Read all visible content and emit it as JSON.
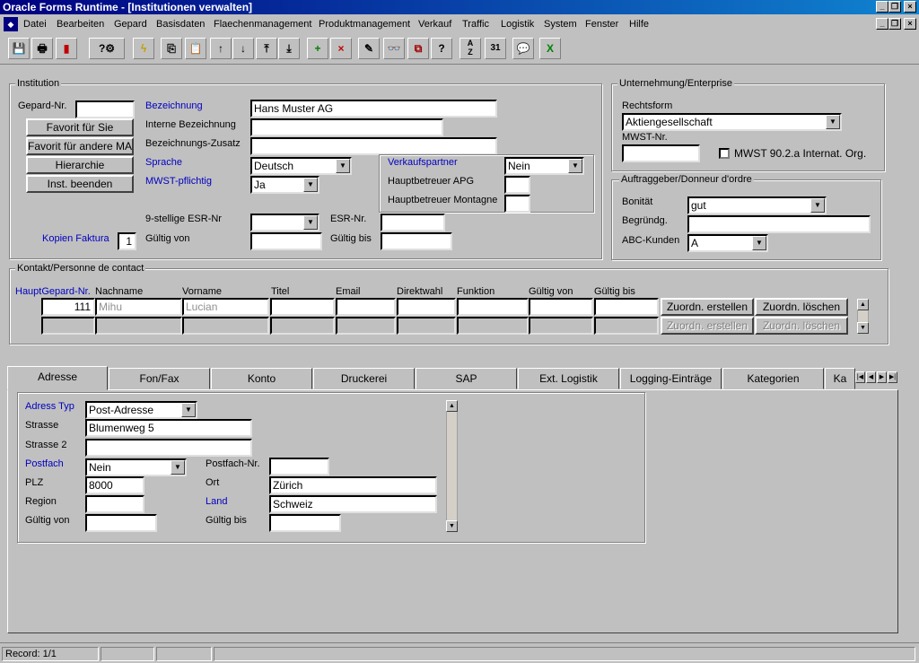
{
  "window": {
    "title": "Oracle Forms Runtime - [Institutionen verwalten]"
  },
  "menu": [
    "Datei",
    "Bearbeiten",
    "Gepard",
    "Basisdaten",
    "Flaechenmanagement",
    "Produktmanagement",
    "Verkauf",
    "Traffic",
    "Logistik",
    "System",
    "Fenster",
    "Hilfe"
  ],
  "toolbar_icons": [
    "save-icon",
    "print-icon",
    "exit-icon",
    "query-icon",
    "execute-icon",
    "copy-icon",
    "paste-icon",
    "prev-record-icon",
    "next-record-icon",
    "first-record-icon",
    "last-record-icon",
    "insert-record-icon",
    "delete-record-icon",
    "clear-icon",
    "find-icon",
    "duplicate-icon",
    "help-icon",
    "sort-icon",
    "calendar-icon",
    "comment-icon",
    "excel-icon"
  ],
  "institution": {
    "group_title": "Institution",
    "gepard_nr_label": "Gepard-Nr.",
    "gepard_nr_value": "",
    "btn_favorit": "Favorit für Sie",
    "btn_favorit_andere": "Favorit für andere MA",
    "btn_hierarchie": "Hierarchie",
    "btn_inst_beenden": "Inst. beenden",
    "bezeichnung_label": "Bezeichnung",
    "bezeichnung_value": "Hans Muster AG",
    "interne_label": "Interne Bezeichnung",
    "interne_value": "",
    "zusatz_label": "Bezeichnungs-Zusatz",
    "zusatz_value": "",
    "sprache_label": "Sprache",
    "sprache_value": "Deutsch",
    "mwst_label": "MWST-pflichtig",
    "mwst_value": "Ja",
    "verkaufspartner_label": "Verkaufspartner",
    "verkaufspartner_value": "Nein",
    "hb_apg_label": "Hauptbetreuer APG",
    "hb_apg_value": "",
    "hb_montagne_label": "Hauptbetreuer Montagne",
    "hb_montagne_value": "",
    "esr9_label": "9-stellige ESR-Nr",
    "esr9_value": "",
    "esr_label": "ESR-Nr.",
    "esr_value": "",
    "kopien_label": "Kopien Faktura",
    "kopien_value": "1",
    "gueltig_von_label": "Gültig von",
    "gueltig_von_value": "",
    "gueltig_bis_label": "Gültig bis",
    "gueltig_bis_value": ""
  },
  "enterprise": {
    "group_title": "Unternehmung/Enterprise",
    "rechtsform_label": "Rechtsform",
    "rechtsform_value": "Aktiengesellschaft",
    "mwst_nr_label": "MWST-Nr.",
    "mwst_nr_value": "",
    "mwst_chk_label": "MWST 90.2.a Internat. Org."
  },
  "auftraggeber": {
    "group_title": "Auftraggeber/Donneur d'ordre",
    "bonitaet_label": "Bonität",
    "bonitaet_value": "gut",
    "begruendg_label": "Begründg.",
    "begruendg_value": "",
    "abc_label": "ABC-Kunden",
    "abc_value": "A"
  },
  "kontakt": {
    "group_title": "Kontakt/Personne de contact",
    "headers": [
      "HauptGepard-Nr.",
      "Nachname",
      "Vorname",
      "Titel",
      "Email",
      "Direktwahl",
      "Funktion",
      "Gültig von",
      "Gültig bis"
    ],
    "row1": [
      "111",
      "Mihu",
      "Lucian",
      "",
      "",
      "",
      "",
      "",
      ""
    ],
    "btn_zuordn_erstellen": "Zuordn. erstellen",
    "btn_zuordn_loeschen": "Zuordn. löschen"
  },
  "tabs": [
    "Adresse",
    "Fon/Fax",
    "Konto",
    "Druckerei",
    "SAP",
    "Ext. Logistik",
    "Logging-Einträge",
    "Kategorien",
    "Ka"
  ],
  "adresse": {
    "adress_typ_label": "Adress Typ",
    "adress_typ_value": "Post-Adresse",
    "strasse_label": "Strasse",
    "strasse_value": "Blumenweg 5",
    "strasse2_label": "Strasse 2",
    "strasse2_value": "",
    "postfach_label": "Postfach",
    "postfach_value": "Nein",
    "postfach_nr_label": "Postfach-Nr.",
    "postfach_nr_value": "",
    "plz_label": "PLZ",
    "plz_value": "8000",
    "ort_label": "Ort",
    "ort_value": "Zürich",
    "region_label": "Region",
    "region_value": "",
    "land_label": "Land",
    "land_value": "Schweiz",
    "gueltig_von_label": "Gültig von",
    "gueltig_von_value": "",
    "gueltig_bis_label": "Gültig bis",
    "gueltig_bis_value": ""
  },
  "status": {
    "record": "Record: 1/1"
  }
}
